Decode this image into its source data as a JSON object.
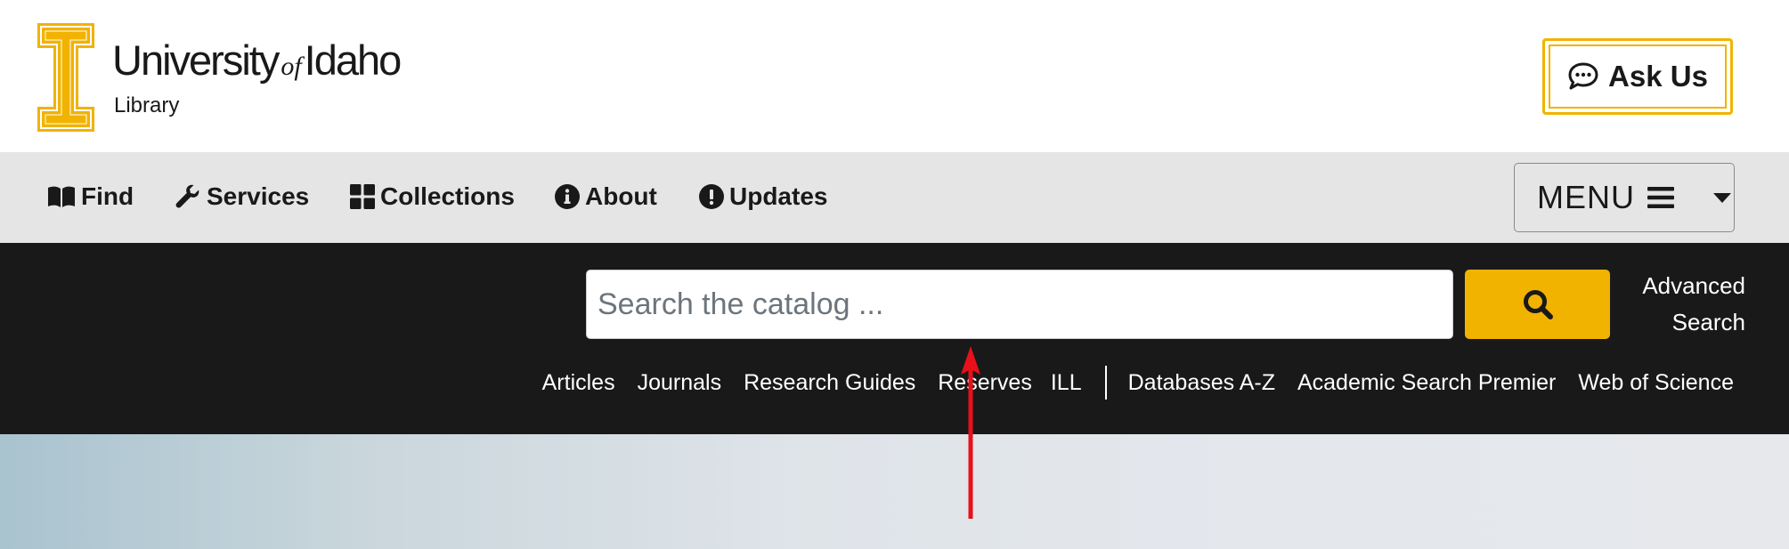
{
  "header": {
    "logo": {
      "title_pre": "University",
      "title_of": "of",
      "title_post": "Idaho",
      "subtitle": "Library"
    },
    "ask_us": {
      "label": "Ask Us",
      "icon": "chat-bubble-icon"
    }
  },
  "nav": {
    "items": [
      {
        "label": "Find",
        "icon": "book-open-icon"
      },
      {
        "label": "Services",
        "icon": "wrench-icon"
      },
      {
        "label": "Collections",
        "icon": "grid-icon"
      },
      {
        "label": "About",
        "icon": "info-circle-icon"
      },
      {
        "label": "Updates",
        "icon": "exclamation-circle-icon"
      }
    ],
    "menu": {
      "label": "MENU",
      "icon": "hamburger-icon"
    }
  },
  "search": {
    "placeholder": "Search the catalog ...",
    "value": "",
    "button_icon": "search-icon",
    "advanced": {
      "line1": "Advanced",
      "line2": "Search"
    }
  },
  "quick_links": [
    "Articles",
    "Journals",
    "Research Guides",
    "Reserves",
    "ILL",
    "Databases A-Z",
    "Academic Search Premier",
    "Web of Science"
  ],
  "colors": {
    "brand_gold": "#f1b300",
    "dark_band": "#191919",
    "nav_bg": "#e5e5e5",
    "annotation_arrow": "#e8101a"
  }
}
